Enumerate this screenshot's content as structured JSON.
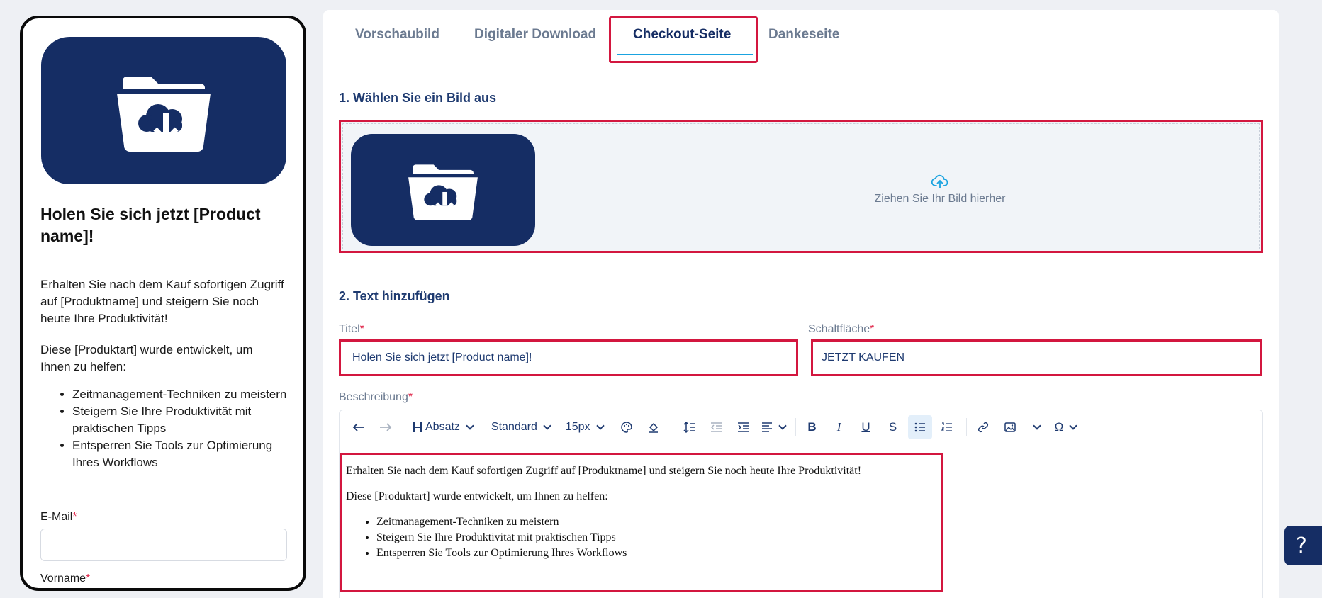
{
  "preview": {
    "title": "Holen Sie sich jetzt [Product name]!",
    "paragraph1": "Erhalten Sie nach dem Kauf sofortigen Zugriff auf [Produktname] und steigern Sie noch heute Ihre Produktivität!",
    "paragraph2": "Diese [Produktart] wurde entwickelt, um Ihnen zu helfen:",
    "bullets": [
      "Zeitmanagement-Techniken zu meistern",
      "Steigern Sie Ihre Produktivität mit praktischen Tipps",
      "Entsperren Sie Tools zur Optimierung Ihres Workflows"
    ],
    "email_label": "E-Mail",
    "vorname_label": "Vorname",
    "required_mark": "*",
    "image_icon": "folder-cloud-download-icon"
  },
  "tabs": [
    {
      "label": "Vorschaubild"
    },
    {
      "label": "Digitaler Download"
    },
    {
      "label": "Checkout-Seite",
      "active": true
    },
    {
      "label": "Dankeseite"
    }
  ],
  "section1": {
    "title": "1. Wählen Sie ein Bild aus",
    "dropzone_hint": "Ziehen Sie Ihr Bild hierher",
    "hint_icon": "cloud-upload-icon"
  },
  "section2": {
    "title": "2. Text hinzufügen",
    "title_label": "Titel",
    "title_value": "Holen Sie sich jetzt [Product name]!",
    "button_label": "Schaltfläche",
    "button_value": "JETZT KAUFEN",
    "description_label": "Beschreibung",
    "required_mark": "*"
  },
  "toolbar": {
    "heading": "Absatz",
    "font": "Standard",
    "size": "15px"
  },
  "editor": {
    "paragraph1": "Erhalten Sie nach dem Kauf sofortigen Zugriff auf [Produktname] und steigern Sie noch heute Ihre Produktivität!",
    "paragraph2": "Diese [Produktart] wurde entwickelt, um Ihnen zu helfen:",
    "bullets": [
      "Zeitmanagement-Techniken zu meistern",
      "Steigern Sie Ihre Produktivität mit praktischen Tipps",
      "Entsperren Sie Tools zur Optimierung Ihres Workflows"
    ]
  },
  "help": {
    "label": "?"
  },
  "colors": {
    "brand_navy": "#152d64",
    "highlight_red": "#d3173f",
    "tab_underline": "#1aa3e0",
    "required": "#e0284b"
  }
}
